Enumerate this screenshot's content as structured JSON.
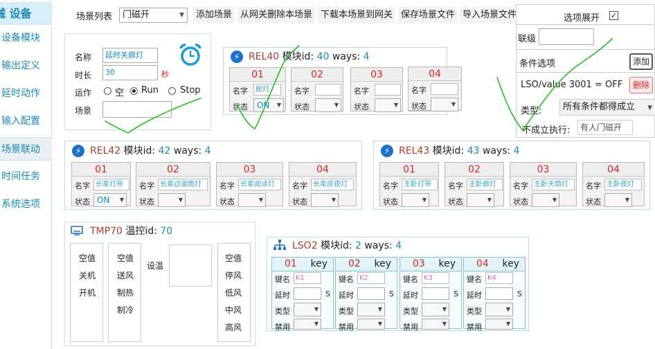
{
  "sidebar": {
    "brand_prefix": "械",
    "brand": "设备",
    "items": [
      {
        "label": "设备模块"
      },
      {
        "label": "输出定义"
      },
      {
        "label": "延时动作"
      },
      {
        "label": "输入配置"
      },
      {
        "label": "场景联动"
      },
      {
        "label": "时间任务"
      },
      {
        "label": "系统选项"
      }
    ]
  },
  "toolbar": {
    "scene_list_label": "场景列表",
    "scene_selected": "门磁开",
    "add_scene": "添加场景",
    "delete_from_gateway": "从网关删除本场景",
    "download_to_gateway": "下载本场景到网关",
    "save_file": "保存场景文件",
    "import_file": "导入场景文件"
  },
  "scene": {
    "name_label": "名称",
    "name_value": "延时关廊灯",
    "duration_label": "时长",
    "duration_value": "30",
    "duration_unit": "秒",
    "run_label": "运作",
    "run_options": [
      "空",
      "Run",
      "Stop"
    ],
    "run_selected": "Run",
    "scene_label": "场景",
    "scene_value": ""
  },
  "options_panel": {
    "expand_label": "选项展开",
    "expand_checked": "✓",
    "cascade_label": "联级",
    "cascade_value": "",
    "conditions_label": "条件选项",
    "add_button": "添加",
    "condition_text": "LSO/value 3001 = OFF",
    "delete_button": "删除",
    "type_label": "类型:",
    "type_value": "所有条件都得成立",
    "else_label": "不成立执行:",
    "else_value": "有人门磁开"
  },
  "rel_modules": [
    {
      "name": "REL40",
      "id_label": "模块id:",
      "id": "40",
      "ways_label": "ways:",
      "ways": "4",
      "slots": [
        {
          "num": "01",
          "name": "廊灯",
          "state": "ON"
        },
        {
          "num": "02",
          "name": "",
          "state": ""
        },
        {
          "num": "03",
          "name": "",
          "state": ""
        },
        {
          "num": "04",
          "name": "",
          "state": ""
        }
      ]
    },
    {
      "name": "REL42",
      "id_label": "模块id:",
      "id": "42",
      "ways_label": "ways:",
      "ways": "4",
      "slots": [
        {
          "num": "01",
          "name": "长辈灯带",
          "state": "ON"
        },
        {
          "num": "02",
          "name": "长辈过道筒灯",
          "state": ""
        },
        {
          "num": "03",
          "name": "长辈阅读灯",
          "state": ""
        },
        {
          "num": "04",
          "name": "长辈房夜灯",
          "state": ""
        }
      ]
    },
    {
      "name": "REL43",
      "id_label": "模块id:",
      "id": "43",
      "ways_label": "ways:",
      "ways": "4",
      "slots": [
        {
          "num": "01",
          "name": "主卧灯带",
          "state": ""
        },
        {
          "num": "02",
          "name": "主卧廊灯",
          "state": ""
        },
        {
          "num": "03",
          "name": "主卧天筒灯",
          "state": ""
        },
        {
          "num": "04",
          "name": "主卧夜灯",
          "state": ""
        }
      ]
    }
  ],
  "slot_labels": {
    "name": "名字",
    "state": "状态"
  },
  "tmp": {
    "name": "TMP70",
    "id_label": "温控id:",
    "id": "70",
    "col1": [
      "空值",
      "关机",
      "开机"
    ],
    "col2": [
      "空值",
      "送风",
      "制热",
      "制冷"
    ],
    "set_temp_label": "设温",
    "col4": [
      "空值",
      "停风",
      "低风",
      "中风",
      "高风"
    ]
  },
  "lso": {
    "name": "LSO2",
    "id_label": "模块id:",
    "id": "2",
    "ways_label": "ways:",
    "ways": "4",
    "key_label": "key",
    "field_labels": {
      "name": "键名",
      "delay": "延时",
      "delay_unit": "S",
      "type": "类型",
      "disable": "禁用"
    },
    "keys": [
      {
        "num": "01",
        "name": "K1"
      },
      {
        "num": "02",
        "name": "K2"
      },
      {
        "num": "03",
        "name": "K3"
      },
      {
        "num": "04",
        "name": "K4"
      }
    ]
  },
  "colors": {
    "accent": "#1a8ab5",
    "slot_number": "#d6261d",
    "module_name": "#b03a2e",
    "scribble": "#22c21f"
  }
}
